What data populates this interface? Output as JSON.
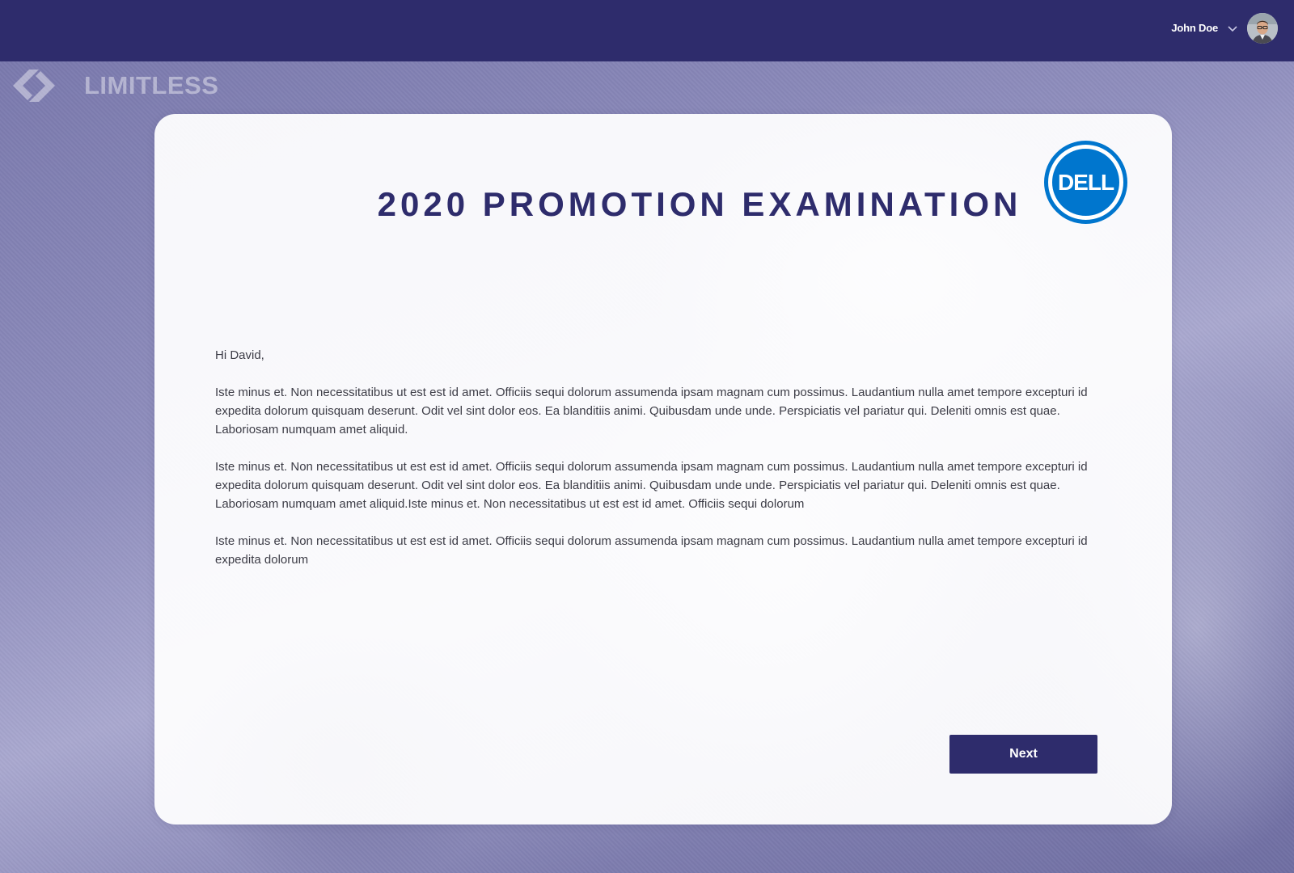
{
  "header": {
    "user_name": "John Doe"
  },
  "brand": {
    "name": "LIMITLESS"
  },
  "card": {
    "title": "2020 PROMOTION EXAMINATION",
    "partner_logo_text": "DELL",
    "greeting": "Hi David,",
    "paragraphs": [
      "Iste minus et. Non necessitatibus ut est est id amet. Officiis sequi dolorum assumenda ipsam magnam cum possimus. Laudantium nulla amet tempore excepturi id expedita dolorum quisquam deserunt. Odit vel sint dolor eos. Ea blanditiis animi. Quibusdam unde unde. Perspiciatis vel pariatur qui. Deleniti omnis est quae. Laboriosam numquam amet aliquid.",
      "Iste minus et. Non necessitatibus ut est est id amet. Officiis sequi dolorum assumenda ipsam magnam cum possimus. Laudantium nulla amet tempore excepturi id expedita dolorum quisquam deserunt. Odit vel sint dolor eos. Ea blanditiis animi. Quibusdam unde unde. Perspiciatis vel pariatur qui. Deleniti omnis est quae. Laboriosam numquam amet aliquid.Iste minus et. Non necessitatibus ut est est id amet. Officiis sequi dolorum",
      "Iste minus et. Non necessitatibus ut est est id amet. Officiis sequi dolorum assumenda ipsam magnam cum possimus. Laudantium nulla amet tempore excepturi id expedita dolorum"
    ],
    "next_label": "Next"
  },
  "colors": {
    "primary": "#2e2c6c",
    "dell_blue": "#0076ce",
    "text": "#3c3c46"
  },
  "icons": {
    "user_menu": "chevron-down-icon",
    "brand": "limitless-logo-icon",
    "partner": "dell-logo-icon"
  }
}
